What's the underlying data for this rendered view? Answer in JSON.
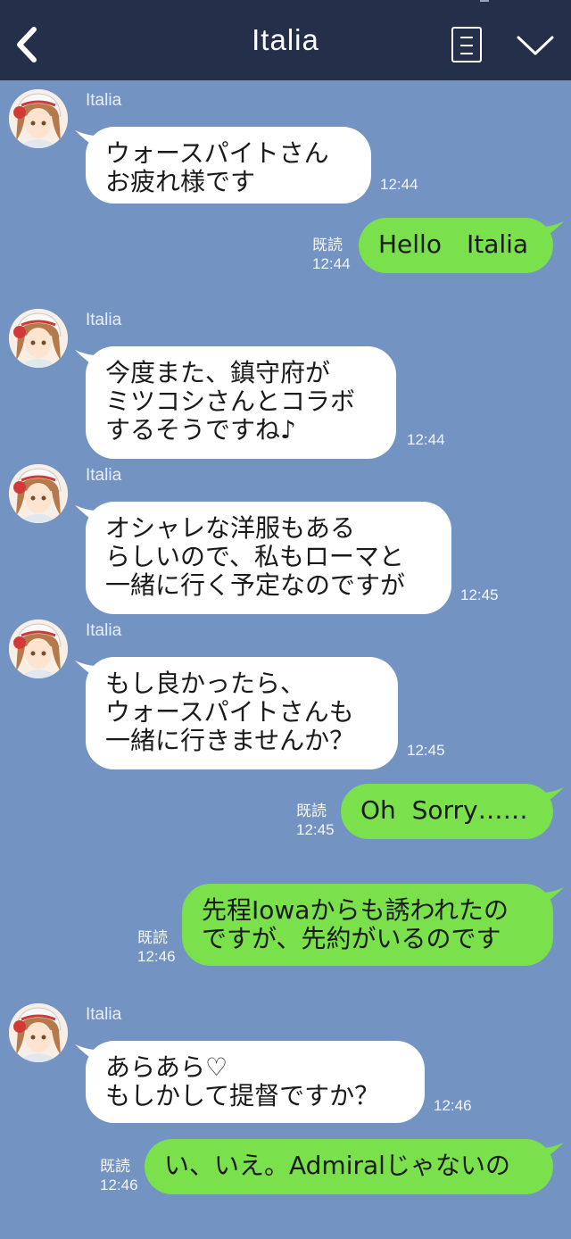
{
  "header": {
    "title": "Italia",
    "back_icon": "chevron-left-icon",
    "menu_icon": "document-menu-icon",
    "collapse_icon": "chevron-down-icon",
    "bg_color": "#243049"
  },
  "colors": {
    "chat_bg": "#7394c2",
    "incoming_bubble": "#ffffff",
    "outgoing_bubble": "#7ae04c"
  },
  "messages": [
    {
      "dir": "in",
      "sender": "Italia",
      "text": "ウォースパイトさん\nお疲れ様です",
      "time": "12:44"
    },
    {
      "dir": "out",
      "read": "既読",
      "text": "Hello　Italia",
      "time": "12:44"
    },
    {
      "dir": "in",
      "sender": "Italia",
      "text": "今度また、鎮守府が\nミツコシさんとコラボ\nするそうですね♪",
      "time": "12:44"
    },
    {
      "dir": "in",
      "sender": "Italia",
      "text": "オシャレな洋服もある\nらしいので、私もローマと\n一緒に行く予定なのですが",
      "time": "12:45"
    },
    {
      "dir": "in",
      "sender": "Italia",
      "text": "もし良かったら、\nウォースパイトさんも\n一緒に行きませんか？",
      "time": "12:45"
    },
    {
      "dir": "out",
      "read": "既読",
      "text": "Oh  Sorry……",
      "time": "12:45"
    },
    {
      "dir": "out",
      "read": "既読",
      "text": "先程Iowaからも誘われたの\nですが、先約がいるのです",
      "time": "12:46"
    },
    {
      "dir": "in",
      "sender": "Italia",
      "text": "あらあら♡\nもしかして提督ですか？",
      "time": "12:46"
    },
    {
      "dir": "out",
      "read": "既読",
      "text": "い、いえ。Admiralじゃないの",
      "time": "12:46"
    }
  ]
}
